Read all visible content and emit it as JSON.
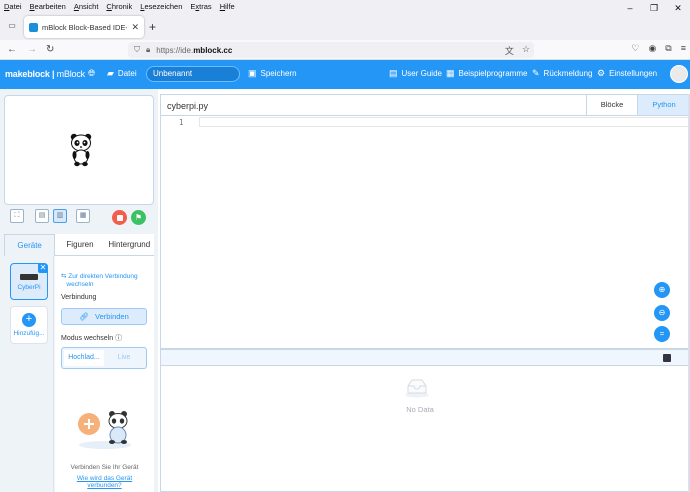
{
  "menu": [
    "Datei",
    "Bearbeiten",
    "Ansicht",
    "Chronik",
    "Lesezeichen",
    "Extras",
    "Hilfe"
  ],
  "menu_underline": [
    "D",
    "B",
    "A",
    "C",
    "L",
    "x",
    "H"
  ],
  "browser_tab": {
    "title": "mBlock Block-Based IDE- Codi"
  },
  "url": {
    "proto": "https://ide.",
    "host": "mblock.cc"
  },
  "app": {
    "logo_brand": "makeblock",
    "logo_product": "mBlock",
    "file_menu": "Datei",
    "project_name": "Unbenannt",
    "save": "Speichern",
    "user_guide": "User Guide",
    "examples": "Beispielprogramme",
    "feedback": "Rückmeldung",
    "settings": "Einstellungen"
  },
  "left_tabs": {
    "devices": "Geräte",
    "sprites": "Figuren",
    "background": "Hintergrund"
  },
  "device": {
    "name": "CyberPi",
    "add": "Hinzufüg..."
  },
  "panel": {
    "direct_link_1": "Zur direkten Verbindung",
    "direct_link_2": "wechseln",
    "connection_label": "Verbindung",
    "connect_button": "Verbinden",
    "mode_label": "Modus wechseln",
    "mode_upload": "Hochlad...",
    "mode_live": "Live",
    "connect_hint": "Verbinden Sie Ihr Gerät",
    "how_link": "Wie wird das Gerät",
    "how_link_2": "verbunden?"
  },
  "editor": {
    "filename": "cyberpi.py",
    "tab_blocks": "Blöcke",
    "tab_python": "Python",
    "line_number": "1"
  },
  "console": {
    "empty": "No Data"
  },
  "colors": {
    "accent": "#2496f5",
    "stop": "#f45c4b",
    "go": "#3cc265"
  },
  "icons": [
    "globe-icon",
    "folder-icon",
    "save-icon",
    "book-icon",
    "image-icon",
    "feedback-icon",
    "gear-icon",
    "zoom-in-icon",
    "zoom-out-icon",
    "zoom-reset-icon"
  ]
}
